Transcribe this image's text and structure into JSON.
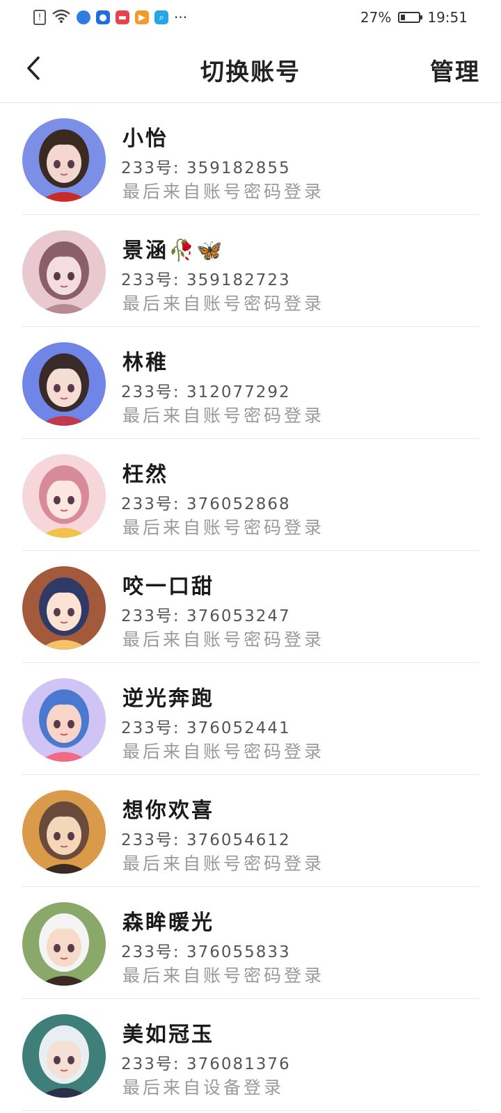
{
  "status_bar": {
    "battery_text": "27%",
    "battery_level": 0.27,
    "time": "19:51",
    "more": "···",
    "icons": [
      "sim-alert-icon",
      "wifi-icon",
      "browser-icon",
      "bulb-app-icon",
      "red-app-icon",
      "video-app-icon",
      "search-app-icon"
    ]
  },
  "header": {
    "back_icon": "chevron-left-icon",
    "title": "切换账号",
    "manage_label": "管理"
  },
  "accounts": [
    {
      "name": "小怡",
      "id": "233号: 359182855",
      "source": "最后来自账号密码登录",
      "avatar_colors": [
        "#7b8fe6",
        "#f2d6cf",
        "#c92a2a",
        "#3a2a22"
      ]
    },
    {
      "name": "景涵🥀🦋",
      "id": "233号: 359182723",
      "source": "最后来自账号密码登录",
      "avatar_colors": [
        "#e9c9cf",
        "#f4dde0",
        "#b78b94",
        "#8a5e6a"
      ]
    },
    {
      "name": "林稚",
      "id": "233号: 312077292",
      "source": "最后来自账号密码登录",
      "avatar_colors": [
        "#6f86e8",
        "#f5ddd4",
        "#c0394f",
        "#3a2a2a"
      ]
    },
    {
      "name": "枉然",
      "id": "233号: 376052868",
      "source": "最后来自账号密码登录",
      "avatar_colors": [
        "#f6d6d8",
        "#fbe7e0",
        "#f0c24a",
        "#d98a9a"
      ]
    },
    {
      "name": "咬一口甜",
      "id": "233号: 376053247",
      "source": "最后来自账号密码登录",
      "avatar_colors": [
        "#a35a3a",
        "#fbe3d4",
        "#f3c36a",
        "#2f3a66"
      ]
    },
    {
      "name": "逆光奔跑",
      "id": "233号: 376052441",
      "source": "最后来自账号密码登录",
      "avatar_colors": [
        "#cfc4f5",
        "#f9d4c8",
        "#f06a84",
        "#4a7ad0"
      ]
    },
    {
      "name": "想你欢喜",
      "id": "233号: 376054612",
      "source": "最后来自账号密码登录",
      "avatar_colors": [
        "#d99a4a",
        "#f4d7b8",
        "#3a2a22",
        "#6a4a3a"
      ]
    },
    {
      "name": "森眸暖光",
      "id": "233号: 376055833",
      "source": "最后来自账号密码登录",
      "avatar_colors": [
        "#8aa86a",
        "#f6dcc8",
        "#3a2a22",
        "#f4f4f4"
      ]
    },
    {
      "name": "美如冠玉",
      "id": "233号: 376081376",
      "source": "最后来自设备登录",
      "avatar_colors": [
        "#3f7f7a",
        "#f4e0d4",
        "#2a2f4a",
        "#e8eef2"
      ]
    }
  ]
}
